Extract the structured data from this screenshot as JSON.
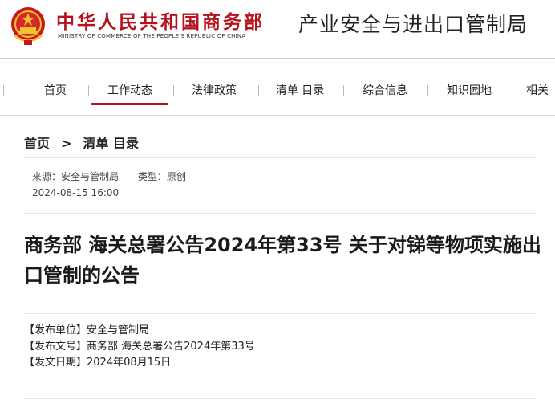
{
  "header": {
    "brand_cn": "中华人民共和国商务部",
    "brand_en": "MINISTRY OF COMMERCE OF THE PEOPLE'S REPUBLIC OF CHINA",
    "bureau_title": "产业安全与进出口管制局"
  },
  "nav": {
    "items": [
      {
        "label": "首页"
      },
      {
        "label": "工作动态"
      },
      {
        "label": "法律政策"
      },
      {
        "label": "清单 目录"
      },
      {
        "label": "综合信息"
      },
      {
        "label": "知识园地"
      },
      {
        "label": "相关"
      }
    ],
    "active": "工作动态"
  },
  "breadcrumb": {
    "home": "首页",
    "separator": ">",
    "current": "清单 目录"
  },
  "meta": {
    "source": "来源：安全与管制局",
    "type": "类型：原创",
    "date": "2024-08-15 16:00"
  },
  "article": {
    "title": "商务部 海关总署公告2024年第33号 关于对锑等物项实施出口管制的公告",
    "publisher": "【发布单位】安全与管制局",
    "doc_number": "【发布文号】商务部 海关总署公告2024年第33号",
    "publish_date": "【发文日期】2024年08月15日"
  },
  "colors": {
    "brand_red": "#b5121b",
    "text": "#222222"
  }
}
